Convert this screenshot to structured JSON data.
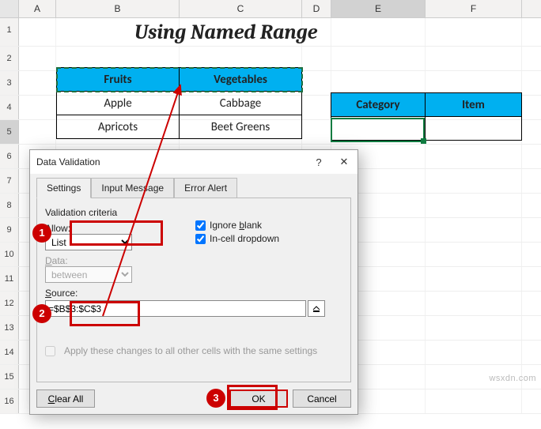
{
  "cols": {
    "A": "A",
    "B": "B",
    "C": "C",
    "D": "D",
    "E": "E",
    "F": "F"
  },
  "rows": [
    "1",
    "2",
    "3",
    "4",
    "5",
    "6",
    "7",
    "8",
    "9",
    "10",
    "11",
    "12",
    "13",
    "14",
    "15",
    "16"
  ],
  "title": "Using Named Range",
  "table1": {
    "h1": "Fruits",
    "h2": "Vegetables",
    "r1c1": "Apple",
    "r1c2": "Cabbage",
    "r2c1": "Apricots",
    "r2c2": "Beet Greens"
  },
  "table2": {
    "h1": "Category",
    "h2": "Item"
  },
  "dialog": {
    "title": "Data Validation",
    "help": "?",
    "close": "✕",
    "tabs": {
      "settings": "Settings",
      "input": "Input Message",
      "error": "Error Alert"
    },
    "criteria_label": "Validation criteria",
    "allow_label": "Allow:",
    "allow_value": "List",
    "data_label": "Data:",
    "data_value": "between",
    "ignore": "Ignore blank",
    "incell": "In-cell dropdown",
    "source_label": "Source:",
    "source_value": "=$B$3:$C$3",
    "apply": "Apply these changes to all other cells with the same settings",
    "clear": "Clear All",
    "ok": "OK",
    "cancel": "Cancel"
  },
  "steps": {
    "1": "1",
    "2": "2",
    "3": "3"
  },
  "watermark": "wsxdn.com"
}
